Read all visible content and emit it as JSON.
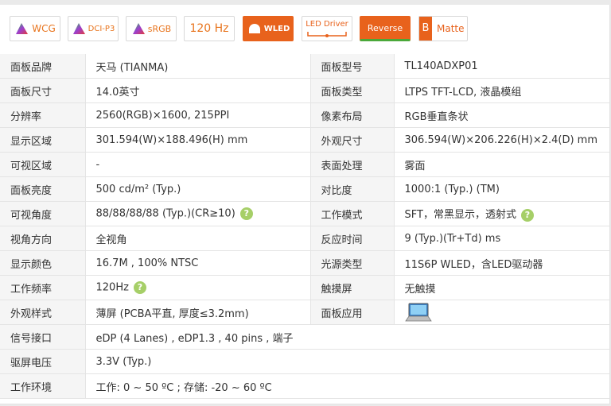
{
  "badges": [
    {
      "id": "wcg",
      "label": "WCG",
      "color": "#e8741d"
    },
    {
      "id": "dcip3",
      "label": "DCI-P3",
      "color": "#e8741d"
    },
    {
      "id": "srgb",
      "label": "sRGB",
      "color": "#e8741d"
    },
    {
      "id": "hz",
      "label": "120 Hz",
      "color": "#e8741d"
    },
    {
      "id": "wled",
      "label": "WLED",
      "color": "#ffffff",
      "bg": "#e8621c"
    },
    {
      "id": "leddriver",
      "label": "LED Driver",
      "color": "#e8621c"
    },
    {
      "id": "reverse",
      "label": "Reverse",
      "color": "#ffffff",
      "bg": "#e8621c"
    },
    {
      "id": "matte",
      "label": "Matte",
      "color": "#e8621c",
      "prefix": "B"
    }
  ],
  "specs": [
    {
      "k1": "面板品牌",
      "v1": "天马 (TIANMA)",
      "k2": "面板型号",
      "v2": "TL140ADXP01"
    },
    {
      "k1": "面板尺寸",
      "v1": "14.0英寸",
      "k2": "面板类型",
      "v2": "LTPS TFT-LCD, 液晶模组"
    },
    {
      "k1": "分辨率",
      "v1": "2560(RGB)×1600, 215PPI",
      "k2": "像素布局",
      "v2": "RGB垂直条状"
    },
    {
      "k1": "显示区域",
      "v1": "301.594(W)×188.496(H) mm",
      "k2": "外观尺寸",
      "v2": "306.594(W)×206.226(H)×2.4(D) mm"
    },
    {
      "k1": "可视区域",
      "v1": "-",
      "k2": "表面处理",
      "v2": "雾面"
    },
    {
      "k1": "面板亮度",
      "v1": "500 cd/m² (Typ.)",
      "k2": "对比度",
      "v2": "1000:1 (Typ.) (TM)"
    },
    {
      "k1": "可视角度",
      "v1": "88/88/88/88 (Typ.)(CR≥10)",
      "k2": "工作模式",
      "v2": "SFT，常黑显示，透射式"
    },
    {
      "k1": "视角方向",
      "v1": "全视角",
      "k2": "反应时间",
      "v2": "9 (Typ.)(Tr+Td) ms"
    },
    {
      "k1": "显示颜色",
      "v1": "16.7M , 100% NTSC",
      "k2": "光源类型",
      "v2": "11S6P WLED，含LED驱动器"
    },
    {
      "k1": "工作频率",
      "v1": "120Hz",
      "k2": "触摸屏",
      "v2": "无触摸"
    },
    {
      "k1": "外观样式",
      "v1": "薄屏 (PCBA平直, 厚度≤3.2mm)",
      "k2": "面板应用",
      "v2": ""
    },
    {
      "k1": "信号接口",
      "v1": "eDP (4 Lanes) , eDP1.3 , 40 pins , 端子"
    },
    {
      "k1": "驱屏电压",
      "v1": "3.3V (Typ.)"
    },
    {
      "k1": "工作环境",
      "v1": "工作: 0 ~ 50 ºC ; 存储: -20 ~ 60 ºC"
    }
  ],
  "help_glyph": "?"
}
